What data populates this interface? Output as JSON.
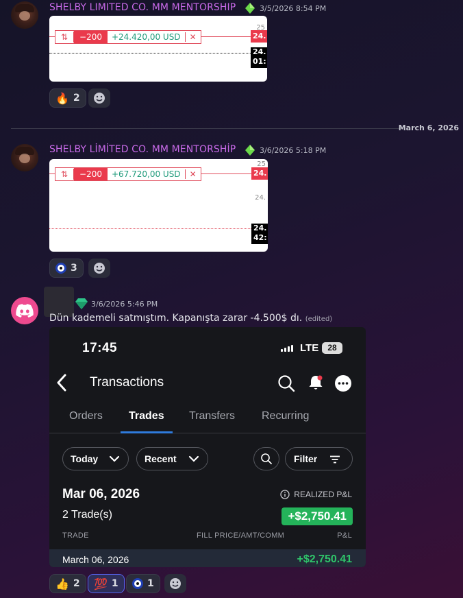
{
  "messages": [
    {
      "username": "SHELBY LIMITED CO. MM MENTORSHIP",
      "timestamp": "3/5/2026 8:54 PM",
      "chart": {
        "qty": "−200",
        "pnl": "+24.420,00 USD",
        "price_tag": "24.",
        "axis_top": "25",
        "black_tag_line1": "24.",
        "black_tag_line2": "01:"
      },
      "reactions": [
        {
          "emoji": "🔥",
          "count": "2"
        }
      ]
    },
    {
      "username": "SHELBY LİMİTED CO. MM MENTORSHİP",
      "timestamp": "3/6/2026 5:18 PM",
      "chart": {
        "qty": "−200",
        "pnl": "+67.720,00 USD",
        "price_tag": "24.",
        "axis_top": "25",
        "axis_mid": "24.",
        "black_tag_line1": "24.",
        "black_tag_line2": "42:"
      },
      "reactions": [
        {
          "emoji": "nazar",
          "count": "3"
        }
      ]
    },
    {
      "timestamp": "3/6/2026 5:46 PM",
      "text": "Dün kademeli satmıştım. Kapanışta zarar -4.500$ dı.",
      "edited": "(edited)",
      "reactions": [
        {
          "emoji": "👍",
          "count": "2"
        },
        {
          "emoji": "💯",
          "count": "1"
        },
        {
          "emoji": "nazar",
          "count": "1"
        }
      ]
    }
  ],
  "divider": {
    "label": "March 6, 2026"
  },
  "phone": {
    "time": "17:45",
    "network": "LTE",
    "battery": "28",
    "title": "Transactions",
    "tabs": [
      "Orders",
      "Trades",
      "Transfers",
      "Recurring"
    ],
    "selected_tab": "Trades",
    "filters": {
      "range": "Today",
      "sort": "Recent",
      "filter": "Filter"
    },
    "date": "Mar 06, 2026",
    "trade_count": "2 Trade(s)",
    "realized_label": "REALIZED P&L",
    "realized_value": "+$2,750.41",
    "columns": [
      "TRADE",
      "FILL PRICE/AMT/COMM",
      "P&L"
    ],
    "row": {
      "date": "March 06, 2026",
      "amount": "+$2,750.41"
    }
  },
  "colors": {
    "username": "#c86ae8",
    "gain": "#24b35a",
    "loss_tag": "#ea3a4c",
    "tab_accent": "#2f7bdc",
    "discord": "#ee4a8f"
  }
}
